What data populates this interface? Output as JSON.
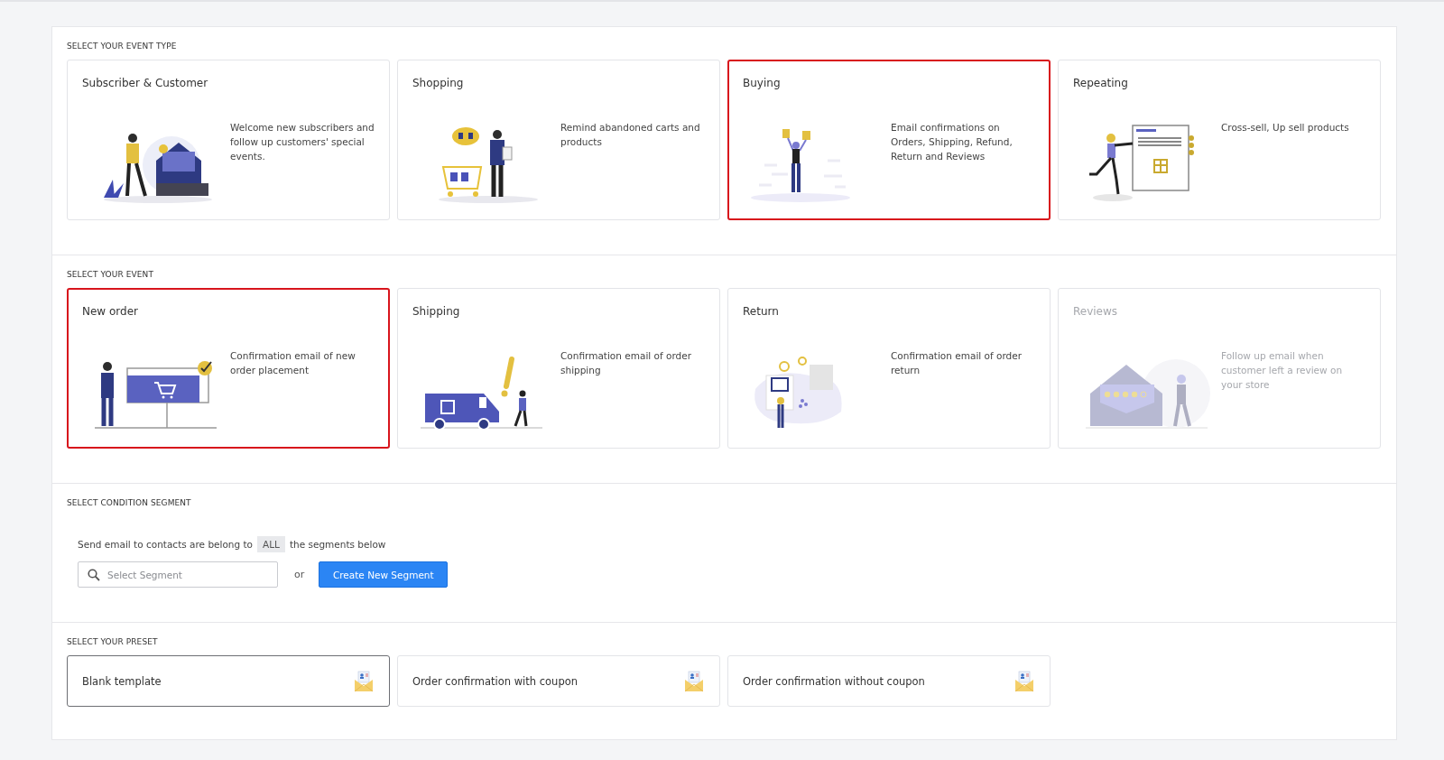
{
  "event_type": {
    "heading": "SELECT YOUR EVENT TYPE",
    "cards": [
      {
        "title": "Subscriber & Customer",
        "description": "Welcome new subscribers and follow up customers' special events.",
        "selected": false,
        "disabled": false
      },
      {
        "title": "Shopping",
        "description": "Remind abandoned carts and products",
        "selected": false,
        "disabled": false
      },
      {
        "title": "Buying",
        "description": "Email confirmations on Orders, Shipping, Refund, Return and Reviews",
        "selected": true,
        "disabled": false
      },
      {
        "title": "Repeating",
        "description": "Cross-sell, Up sell products",
        "selected": false,
        "disabled": false
      }
    ]
  },
  "event": {
    "heading": "SELECT YOUR EVENT",
    "cards": [
      {
        "title": "New order",
        "description": "Confirmation email of new order placement",
        "selected": true,
        "disabled": false
      },
      {
        "title": "Shipping",
        "description": "Confirmation email of order shipping",
        "selected": false,
        "disabled": false
      },
      {
        "title": "Return",
        "description": "Confirmation email of order return",
        "selected": false,
        "disabled": false
      },
      {
        "title": "Reviews",
        "description": "Follow up email when customer left a review on your store",
        "selected": false,
        "disabled": true
      }
    ]
  },
  "condition": {
    "heading": "SELECT CONDITION SEGMENT",
    "sentence_before": "Send email to contacts are belong to",
    "match_mode": "ALL",
    "sentence_after": "the segments below",
    "search": {
      "placeholder": "Select Segment"
    },
    "or_label": "or",
    "create_button": "Create New Segment"
  },
  "preset": {
    "heading": "SELECT YOUR PRESET",
    "items": [
      {
        "label": "Blank template",
        "selected": true
      },
      {
        "label": "Order confirmation with coupon",
        "selected": false
      },
      {
        "label": "Order confirmation without coupon",
        "selected": false
      }
    ]
  }
}
